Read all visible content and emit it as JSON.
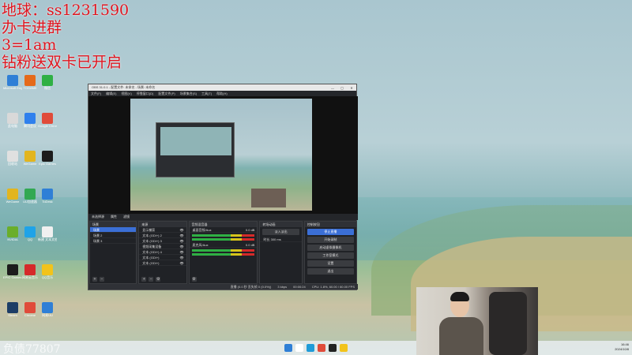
{
  "overlay": {
    "lines": [
      "地球：ss1231590",
      "办卡进群",
      "3=1am",
      "钻粉送双卡已开启"
    ],
    "watermark": "负债77807"
  },
  "desktop_icons": [
    {
      "label": "Microsoft Edge",
      "color": "#2f7fd6",
      "icon": "edge-icon"
    },
    {
      "label": "此电脑",
      "color": "#d9d9d9",
      "icon": "computer-icon"
    },
    {
      "label": "回收站",
      "color": "#e0e0e0",
      "icon": "recycle-bin-icon"
    },
    {
      "label": "WeGame",
      "color": "#e2b51f",
      "icon": "wegame-icon"
    },
    {
      "label": "NVIDIA",
      "color": "#6aae2a",
      "icon": "nvidia-icon"
    },
    {
      "label": "EPIC Games Launcher",
      "color": "#1c1c1c",
      "icon": "epic-icon"
    },
    {
      "label": "Steam",
      "color": "#1d3d66",
      "icon": "steam-icon"
    },
    {
      "label": "TOGAME",
      "color": "#e56a1a",
      "icon": "game-icon"
    },
    {
      "label": "腾讯会议",
      "color": "#2f80ed",
      "icon": "meeting-icon"
    },
    {
      "label": "WeGame",
      "color": "#e2b51f",
      "icon": "wegame-icon"
    },
    {
      "label": "UU加速器",
      "color": "#32a852",
      "icon": "uu-icon"
    },
    {
      "label": "QQ",
      "color": "#1fa3e8",
      "icon": "qq-icon"
    },
    {
      "label": "网易云音乐",
      "color": "#d52a2a",
      "icon": "music-icon"
    },
    {
      "label": "Chrome",
      "color": "#e04b3a",
      "icon": "chrome-icon"
    },
    {
      "label": "微信",
      "color": "#2fb044",
      "icon": "wechat-icon"
    },
    {
      "label": "Google Chrome",
      "color": "#e04b3a",
      "icon": "chrome-icon"
    },
    {
      "label": "Epic Games",
      "color": "#1c1c1c",
      "icon": "epic-icon"
    },
    {
      "label": "ToDesk",
      "color": "#2f7fd6",
      "icon": "todesk-icon"
    },
    {
      "label": "新建 文本文档",
      "color": "#f0f0f0",
      "icon": "text-file-icon"
    },
    {
      "label": "QQ音乐",
      "color": "#f2c31b",
      "icon": "qqmusic-icon"
    },
    {
      "label": "网易UU",
      "color": "#2f7fd6",
      "icon": "uu-icon"
    }
  ],
  "obs": {
    "title": "OBS 31.0.1 - 配置文件: 未命名 - 场景: 未命名",
    "menu": [
      "文件(F)",
      "编辑(E)",
      "视图(V)",
      "停靠窗口(D)",
      "配置文件(P)",
      "场景集合(S)",
      "工具(T)",
      "帮助(H)"
    ],
    "controls_row": [
      "未选择源",
      "属性",
      "滤镜"
    ],
    "scenes_title": "场景",
    "scenes": [
      "场景",
      "场景 2",
      "场景 3"
    ],
    "sources_title": "来源",
    "sources": [
      "显示捕获",
      "文本 (GDI+) 2",
      "文本 (GDI+) 3",
      "视频采集设备",
      "文本 (GDI+) 4",
      "文本 (GDI+)",
      "文本 (GDI+)"
    ],
    "mixer_title": "音频混音器",
    "mixer": [
      {
        "name": "桌面音频/Aux",
        "db": "0.0 dB"
      },
      {
        "name": "麦克风/Aux",
        "db": "0.0 dB"
      }
    ],
    "transitions_title": "转场动画",
    "transition_value": "淡入淡出",
    "duration_label": "时长",
    "duration_value": "300 ms",
    "controls_title": "控制按钮",
    "buttons": [
      "停止直播",
      "开始录制",
      "启动虚拟摄像机",
      "工作室模式",
      "设置",
      "退出"
    ],
    "status": [
      "直播 (0.0 秒 丢失帧 0 (0.0%))",
      "3 kbps",
      "00:00:24",
      "CPU: 1.8%, 60.00 / 60.00 FPS"
    ]
  },
  "taskbar": {
    "apps": [
      "windows-start-icon",
      "search-icon",
      "edge-icon",
      "chrome-icon",
      "obs-icon",
      "explorer-icon"
    ],
    "colors": [
      "#2f7fd6",
      "#ffffff",
      "#1f9bd8",
      "#e04b3a",
      "#222222",
      "#f2c31b"
    ],
    "time": "16:46",
    "date": "2024/10/8"
  }
}
